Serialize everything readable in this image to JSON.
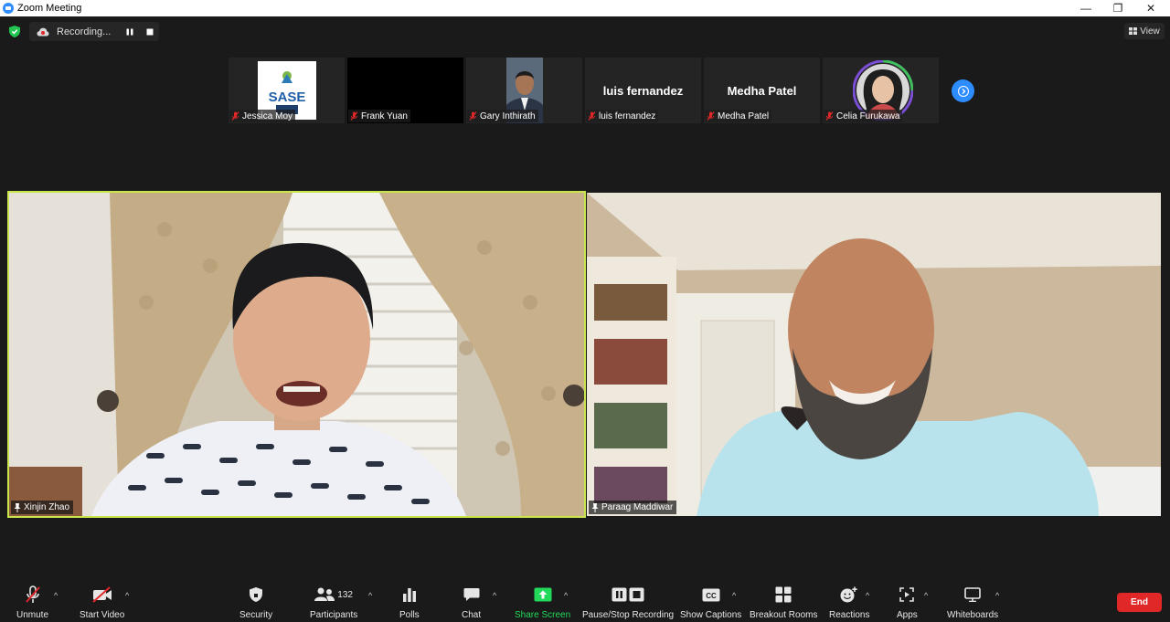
{
  "window": {
    "title": "Zoom Meeting",
    "minimize": "—",
    "restore": "❐",
    "close": "✕"
  },
  "recording": {
    "label": "Recording..."
  },
  "view_button": {
    "label": "View"
  },
  "participant_strip": [
    {
      "name": "Jessica Moy",
      "type": "logo",
      "logo_text": "SASE"
    },
    {
      "name": "Frank Yuan",
      "type": "video-off-black"
    },
    {
      "name": "Gary Inthirath",
      "type": "photo"
    },
    {
      "name": "luis fernandez",
      "type": "name-only",
      "display": "luis fernandez"
    },
    {
      "name": "Medha Patel",
      "type": "name-only",
      "display": "Medha Patel"
    },
    {
      "name": "Celia Furukawa",
      "type": "photo"
    }
  ],
  "main_videos": [
    {
      "name": "Xinjin Zhao",
      "active_speaker": true
    },
    {
      "name": "Paraag Maddiwar",
      "active_speaker": false
    }
  ],
  "toolbar": {
    "unmute": "Unmute",
    "start_video": "Start Video",
    "security": "Security",
    "participants": "Participants",
    "participants_count": "132",
    "polls": "Polls",
    "chat": "Chat",
    "share_screen": "Share Screen",
    "pause_stop_recording": "Pause/Stop Recording",
    "show_captions": "Show Captions",
    "breakout_rooms": "Breakout Rooms",
    "reactions": "Reactions",
    "apps": "Apps",
    "whiteboards": "Whiteboards",
    "end": "End"
  },
  "colors": {
    "accent": "#2d8cff",
    "active_speaker_border": "#c8e64b",
    "share_green": "#23d959",
    "end_red": "#e02828",
    "muted_red": "#e02828"
  }
}
